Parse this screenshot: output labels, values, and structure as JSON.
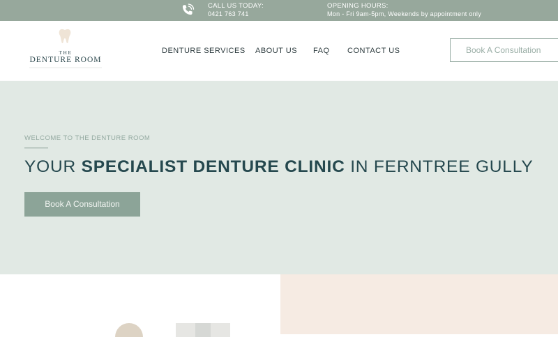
{
  "topbar": {
    "call_title": "CALL US TODAY:",
    "call_number": "0421 763 741",
    "hours_title": "OPENING HOURS:",
    "hours_text": "Mon - Fri 9am-5pm, Weekends by appointment only",
    "phone_icon": "phone-ringing-icon"
  },
  "logo": {
    "line1": "THE",
    "line2": "DENTURE ROOM",
    "icon": "tooth-icon"
  },
  "nav": {
    "items": [
      {
        "label": "DENTURE SERVICES"
      },
      {
        "label": "ABOUT US"
      },
      {
        "label": "FAQ"
      },
      {
        "label": "CONTACT US"
      }
    ],
    "cta_label": "Book A Consultation"
  },
  "hero": {
    "kicker": "WELCOME TO THE DENTURE ROOM",
    "title_prefix": "YOUR ",
    "title_bold": "SPECIALIST DENTURE CLINIC",
    "title_suffix": " IN FERNTREE GULLY",
    "cta_label": "Book A Consultation"
  },
  "colors": {
    "topbar_bg": "#97a89c",
    "hero_bg": "#e1e9e4",
    "accent": "#8ca498",
    "heading": "#25484e",
    "peach_panel": "#f6ebe3"
  }
}
